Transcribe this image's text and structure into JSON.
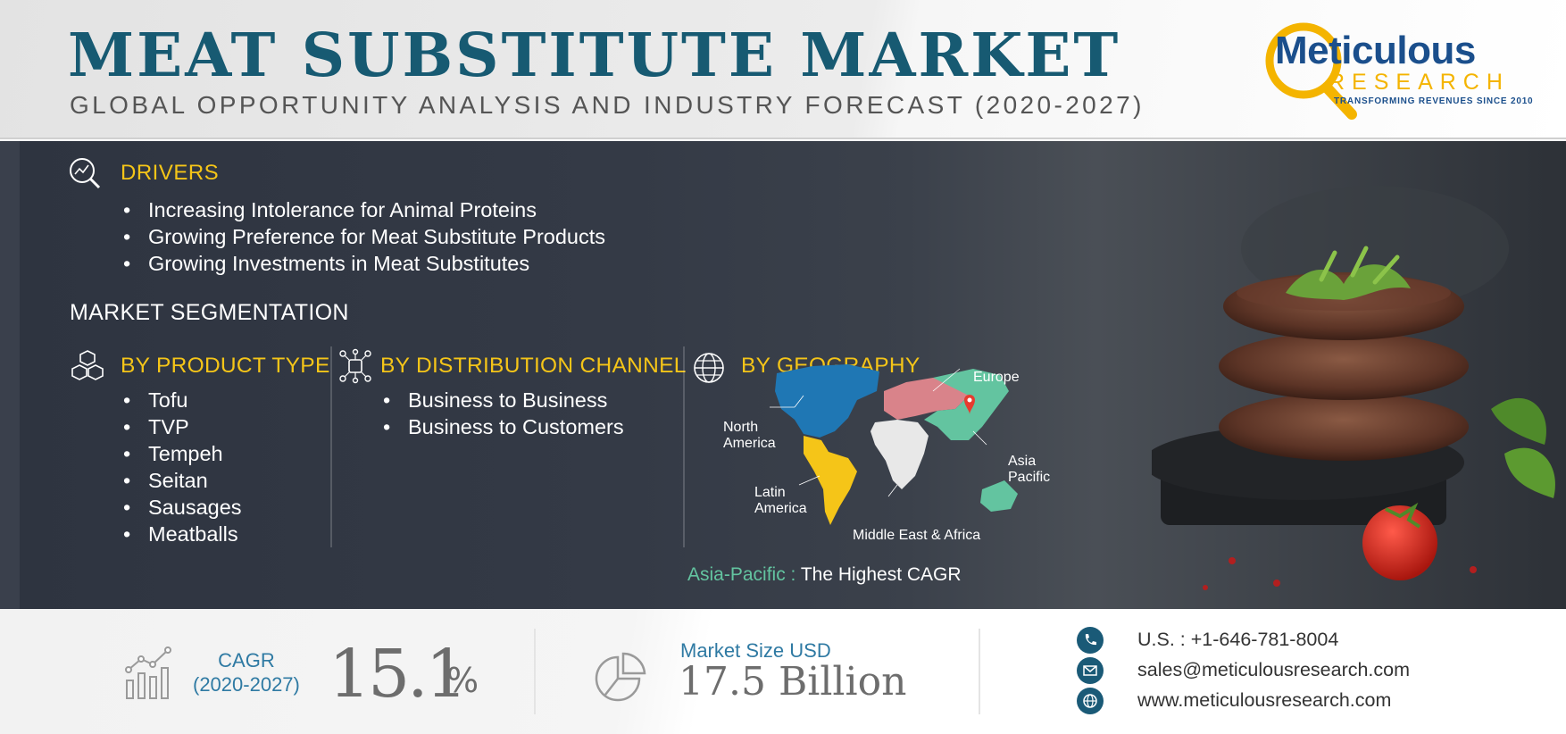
{
  "header": {
    "title": "MEAT SUBSTITUTE MARKET",
    "subtitle": "GLOBAL OPPORTUNITY ANALYSIS AND INDUSTRY FORECAST (2020-2027)"
  },
  "logo": {
    "name": "Meticulous",
    "research": "RESEARCH",
    "tagline": "TRANSFORMING REVENUES SINCE 2010"
  },
  "drivers": {
    "title": "DRIVERS",
    "items": [
      "Increasing Intolerance for Animal Proteins",
      "Growing Preference for Meat Substitute Products",
      "Growing Investments in Meat Substitutes"
    ]
  },
  "segmentation": {
    "title": "MARKET SEGMENTATION",
    "product_type": {
      "title": "BY PRODUCT TYPE",
      "items": [
        "Tofu",
        "TVP",
        "Tempeh",
        "Seitan",
        "Sausages",
        "Meatballs"
      ]
    },
    "distribution": {
      "title": "BY DISTRIBUTION CHANNEL",
      "items": [
        "Business to Business",
        "Business to Customers"
      ]
    },
    "geography": {
      "title": "BY GEOGRAPHY",
      "regions": {
        "europe": "Europe",
        "north_america_1": "North",
        "north_america_2": "America",
        "latin_america_1": "Latin",
        "latin_america_2": "America",
        "asia_pacific_1": "Asia",
        "asia_pacific_2": "Pacific",
        "mea": "Middle East & Africa"
      },
      "highlight_region": "Asia-Pacific :",
      "highlight_text": " The Highest CAGR",
      "colors": {
        "north_america": "#1f77b4",
        "latin_america": "#f5c518",
        "europe": "#d9838a",
        "asia_pacific": "#63c4a0",
        "mea": "#e8e8e8"
      }
    }
  },
  "footer": {
    "cagr_label_1": "CAGR",
    "cagr_label_2": "(2020-2027)",
    "cagr_value": "15.1",
    "cagr_unit": "%",
    "market_size_label": "Market Size USD",
    "market_size_value": "17.5 Billion",
    "phone": "U.S. : +1-646-781-8004",
    "email": "sales@meticulousresearch.com",
    "website": "www.meticulousresearch.com"
  },
  "colors": {
    "title": "#175a72",
    "accent_yellow": "#f5c518",
    "accent_blue": "#2f7aa3",
    "dark_panel": "#343a46"
  }
}
